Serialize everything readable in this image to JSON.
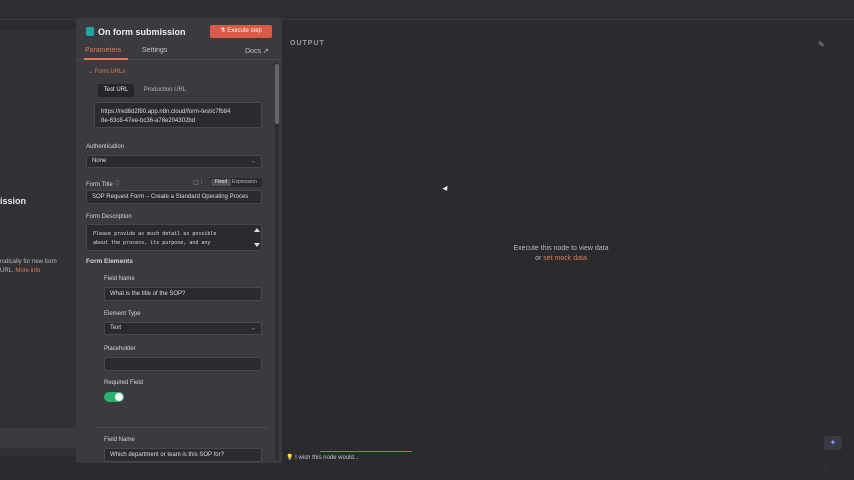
{
  "left": {
    "title": "ission",
    "text_line1": "natically for new form",
    "text_line2": "URL.",
    "more_info": "More info"
  },
  "panel": {
    "title": "On form submission",
    "execute_label": "Execute step",
    "tabs": [
      "Parameters",
      "Settings"
    ],
    "docs_label": "Docs"
  },
  "form_urls": {
    "label": "Form URLs",
    "tab_test": "Test URL",
    "tab_prod": "Production URL",
    "url_line1": "https://red8d2f80.app.n8n.cloud/form-test/c7fb84",
    "url_line2": "8e-63c8-47ee-bc36-a78e204302bd"
  },
  "authentication": {
    "label": "Authentication",
    "value": "None"
  },
  "form_title": {
    "label": "Form Title",
    "mode_fixed": "Fixed",
    "mode_expression": "Expression",
    "value": "SOP Request Form – Create a Standard Operating Proces"
  },
  "form_description": {
    "label": "Form Description",
    "line1": "Please provide as much detail as possible",
    "line2": "about the process, its purpose, and any"
  },
  "form_elements": {
    "label": "Form Elements",
    "field_name_label": "Field Name",
    "field_name_value": "What is the title of the SOP?",
    "element_type_label": "Element Type",
    "element_type_value": "Text",
    "placeholder_label": "Placeholder",
    "placeholder_value": "",
    "required_label": "Required Field",
    "required_on": true,
    "field2_name_label": "Field Name",
    "field2_name_value": "Which department or team is this SOP for?"
  },
  "output": {
    "label": "OUTPUT",
    "message": "Execute this node to view data",
    "or_text": "or",
    "mock_link": "set mock data"
  },
  "ask": {
    "placeholder": "I wish this node would..."
  },
  "colors": {
    "accent": "#e07a55",
    "execute": "#d95b45",
    "toggle_on": "#29b46d",
    "node_icon": "#1fa7a0"
  },
  "icons": [
    "form-node-icon",
    "flask-icon",
    "external-link-icon",
    "chevron-down-icon",
    "info-icon",
    "pencil-icon",
    "sparkle-icon",
    "lightbulb-icon"
  ]
}
